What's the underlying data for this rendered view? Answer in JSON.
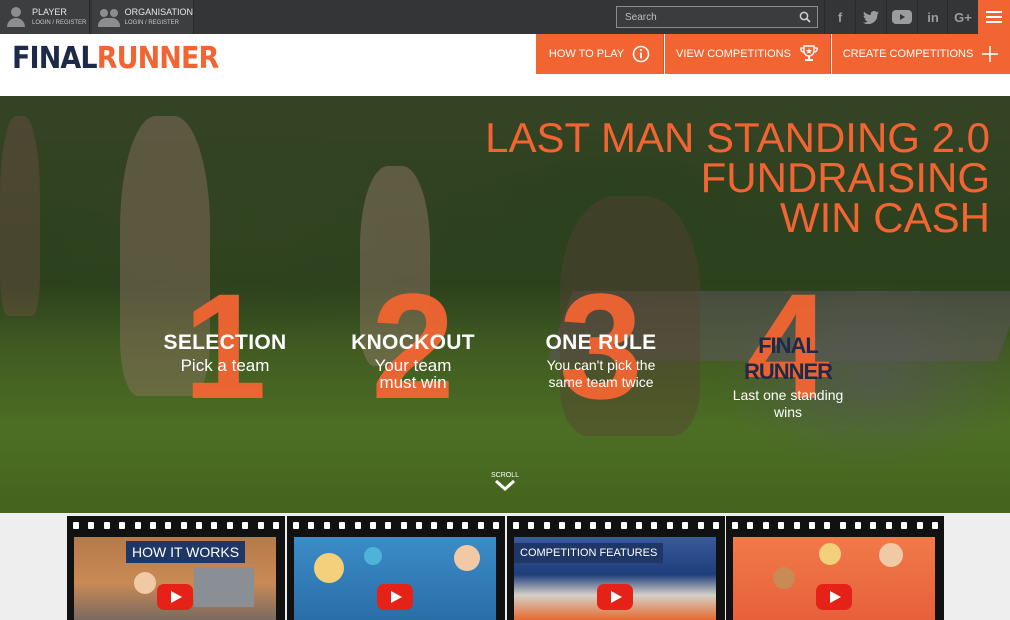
{
  "topbar": {
    "player": {
      "title": "PLAYER",
      "sub": "LOGIN / REGISTER"
    },
    "organisation": {
      "title": "ORGANISATION",
      "sub": "LOGIN / REGISTER"
    },
    "search_placeholder": "Search",
    "social": [
      {
        "icon": "facebook-icon",
        "glyph": "f"
      },
      {
        "icon": "twitter-icon",
        "glyph": "t"
      },
      {
        "icon": "youtube-icon",
        "glyph": "▶"
      },
      {
        "icon": "linkedin-icon",
        "glyph": "in"
      },
      {
        "icon": "google-plus-icon",
        "glyph": "G+"
      }
    ],
    "menu_icon": "hamburger-menu-icon"
  },
  "nav": {
    "logo_part1": "FINAL",
    "logo_part2": "RUNNER",
    "buttons": [
      {
        "label": "HOW TO PLAY",
        "icon": "info-icon"
      },
      {
        "label": "VIEW COMPETITIONS",
        "icon": "trophy-icon"
      },
      {
        "label": "CREATE COMPETITIONS",
        "icon": "plus-icon"
      }
    ]
  },
  "hero": {
    "headline": [
      "LAST MAN STANDING 2.0",
      "FUNDRAISING",
      "WIN CASH"
    ],
    "steps": [
      {
        "num": "1",
        "title": "SELECTION",
        "sub": "Pick a team"
      },
      {
        "num": "2",
        "title": "KNOCKOUT",
        "sub": "Your team must win"
      },
      {
        "num": "3",
        "title": "ONE RULE",
        "sub": "You can't pick the same team twice"
      },
      {
        "num": "4",
        "title": "FINAL RUNNER",
        "sub": "Last one standing wins"
      }
    ],
    "scroll_label": "SCROLL"
  },
  "videos": [
    {
      "label": "HOW IT WORKS",
      "bg": "#c98a55"
    },
    {
      "label": "",
      "bg": "#2a6ea8"
    },
    {
      "label": "COMPETITION FEATURES",
      "bg": "#1d3e7a"
    },
    {
      "label": "",
      "bg": "#e8603a"
    }
  ],
  "colors": {
    "accent": "#f26532",
    "navy": "#1e2a4a",
    "topbar": "#333537"
  }
}
